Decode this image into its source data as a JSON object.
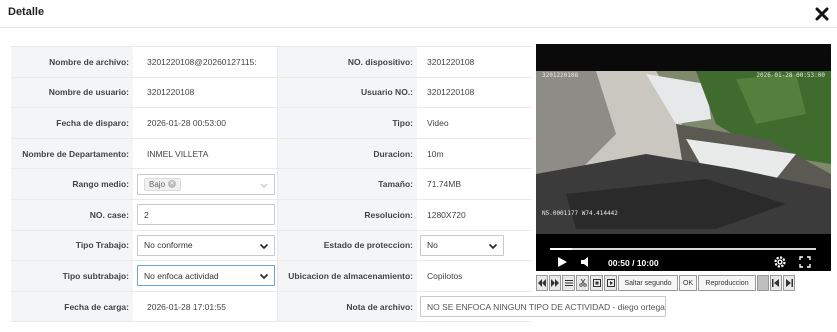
{
  "dialog": {
    "title": "Detalle"
  },
  "fields": {
    "nombre_archivo": {
      "label": "Nombre de archivo:",
      "value": "3201220108@20260127115:"
    },
    "no_dispositivo": {
      "label": "NO. dispositivo:",
      "value": "3201220108"
    },
    "nombre_usuario": {
      "label": "Nombre de usuario:",
      "value": "3201220108"
    },
    "usuario_no": {
      "label": "Usuario NO.:",
      "value": "3201220108"
    },
    "fecha_disparo": {
      "label": "Fecha de disparo:",
      "value": "2026-01-28 00:53:00"
    },
    "tipo": {
      "label": "Tipo:",
      "value": "Video"
    },
    "departamento": {
      "label": "Nombre de Departamento:",
      "value": "INMEL VILLETA"
    },
    "duracion": {
      "label": "Duracion:",
      "value": "10m"
    },
    "rango_medio": {
      "label": "Rango medio:",
      "value": "Bajo"
    },
    "tamano": {
      "label": "Tamaño:",
      "value": "71.74MB"
    },
    "no_case": {
      "label": "NO. case:",
      "value": "2"
    },
    "resolucion": {
      "label": "Resolucion:",
      "value": "1280X720"
    },
    "tipo_trabajo": {
      "label": "Tipo Trabajo:",
      "value": "No conforme"
    },
    "estado_proteccion": {
      "label": "Estado de proteccion:",
      "value": "No"
    },
    "tipo_subtrabajo": {
      "label": "Tipo subtrabajo:",
      "value": "No enfoca actividad"
    },
    "ubicacion": {
      "label": "Ubicacion de almacenamiento:",
      "value": "Copilotos"
    },
    "fecha_carga": {
      "label": "Fecha de carga:",
      "value": "2026-01-28 17:01:55"
    },
    "nota_archivo": {
      "label": "Nota de archivo:",
      "value": "NO SE ENFOCA NINGUN TIPO DE ACTIVIDAD  - diego ortega"
    }
  },
  "video": {
    "overlay_top_left": "3201220108",
    "overlay_top_right": "2026-01-28 00:53:00",
    "overlay_bottom_left": "N5.0001177 W74.414442",
    "time_display": "00:50 / 10:00",
    "progress": 0.083
  },
  "toolbar": {
    "saltar_label": "Saltar segundo",
    "ok_label": "OK",
    "reproduccion_label": "Reproduccion"
  },
  "colors": {
    "accent_focus": "#6aa6d6",
    "label_bg": "#f4f5f7"
  }
}
